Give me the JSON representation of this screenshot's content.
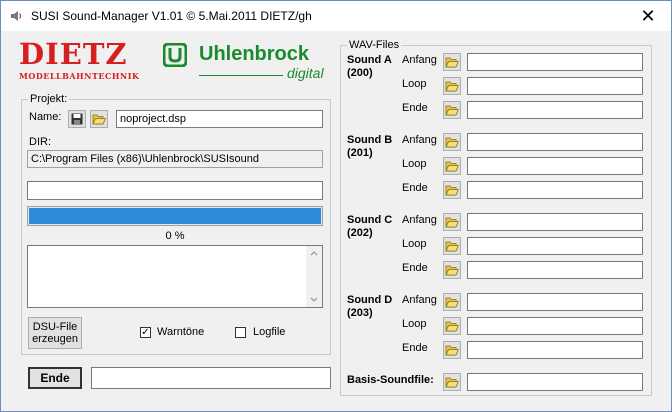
{
  "window": {
    "title": "SUSI Sound-Manager V1.01  ©  5.Mai.2011 DIETZ/gh",
    "close_glyph": "✕"
  },
  "logos": {
    "dietz_main": "DIETZ",
    "dietz_sub": "MODELLBAHNTECHNIK",
    "uhl_main": "Uhlenbrock",
    "uhl_sub": "digital",
    "dietz_color": "#d42020",
    "uhl_color": "#1a8a2e"
  },
  "project": {
    "legend": "Projekt:",
    "name_label": "Name:",
    "name_value": "noproject.dsp",
    "dir_label": "DIR:",
    "dir_value": "C:\\Program Files (x86)\\Uhlenbrock\\SUSIsound",
    "status_value": "",
    "progress_percent": 100,
    "progress_text": "0 %",
    "log_value": "",
    "dsu_button": "DSU-File\nerzeugen",
    "warn_label": "Warntöne",
    "warn_checked": true,
    "logfile_label": "Logfile",
    "logfile_checked": false
  },
  "footer": {
    "end_button": "Ende",
    "status_value": ""
  },
  "wav": {
    "legend": "WAV-Files",
    "sounds": [
      {
        "name": "Sound A",
        "id": "(200)",
        "rows": [
          {
            "label": "Anfang",
            "value": ""
          },
          {
            "label": "Loop",
            "value": ""
          },
          {
            "label": "Ende",
            "value": ""
          }
        ]
      },
      {
        "name": "Sound B",
        "id": "(201)",
        "rows": [
          {
            "label": "Anfang",
            "value": ""
          },
          {
            "label": "Loop",
            "value": ""
          },
          {
            "label": "Ende",
            "value": ""
          }
        ]
      },
      {
        "name": "Sound C",
        "id": "(202)",
        "rows": [
          {
            "label": "Anfang",
            "value": ""
          },
          {
            "label": "Loop",
            "value": ""
          },
          {
            "label": "Ende",
            "value": ""
          }
        ]
      },
      {
        "name": "Sound D",
        "id": "(203)",
        "rows": [
          {
            "label": "Anfang",
            "value": ""
          },
          {
            "label": "Loop",
            "value": ""
          },
          {
            "label": "Ende",
            "value": ""
          }
        ]
      }
    ],
    "basis_label": "Basis-Soundfile:",
    "basis_value": ""
  }
}
